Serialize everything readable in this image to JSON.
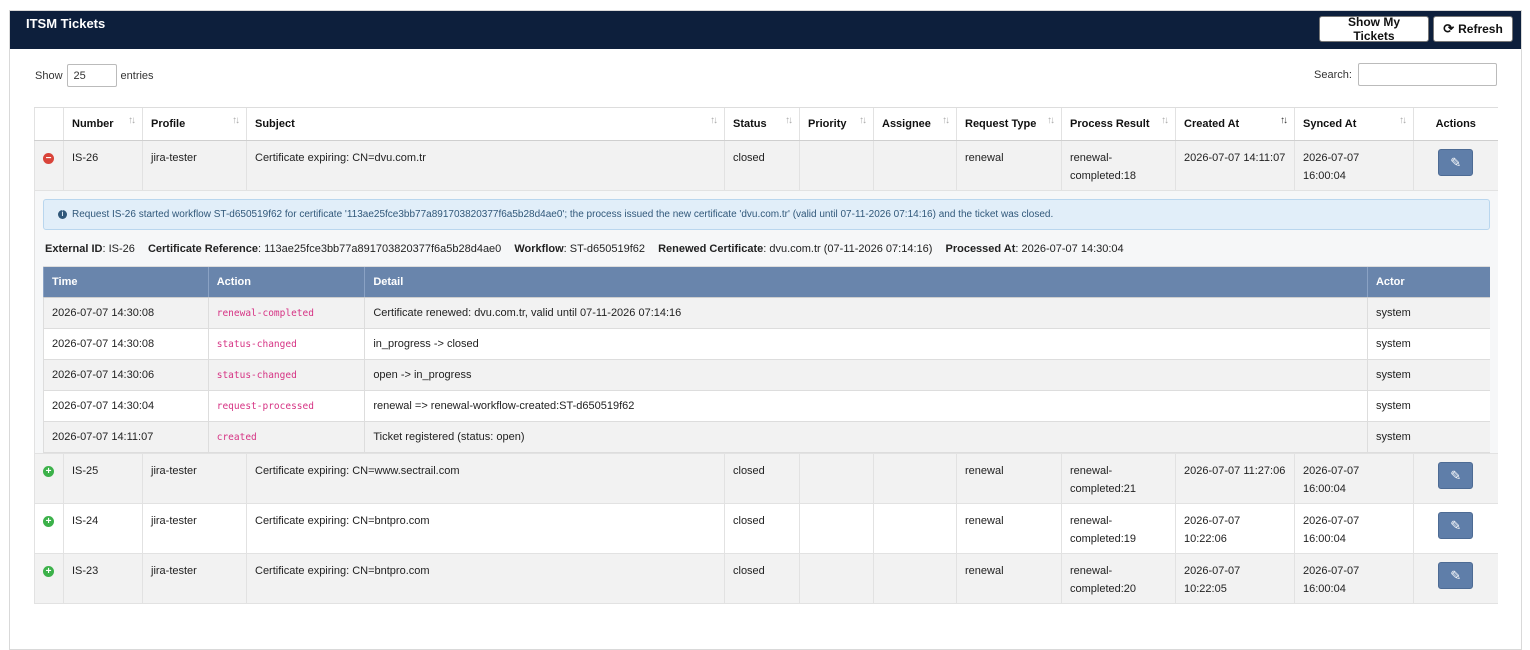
{
  "header": {
    "title": "ITSM Tickets",
    "show_my_tickets": "Show My Tickets",
    "refresh": "Refresh"
  },
  "controls": {
    "show_label": "Show",
    "page_length": "25",
    "entries_label": "entries",
    "search_label": "Search:"
  },
  "columns": [
    "Number",
    "Profile",
    "Subject",
    "Status",
    "Priority",
    "Assignee",
    "Request Type",
    "Process Result",
    "Created At",
    "Synced At",
    "Actions"
  ],
  "rows": [
    {
      "number": "IS-26",
      "profile": "jira-tester",
      "subject": "Certificate expiring: CN=dvu.com.tr",
      "status": "closed",
      "priority": "",
      "assignee": "",
      "request_type": "renewal",
      "process_result": "renewal-completed:18",
      "created_at": "2026-07-07 14:11:07",
      "synced_at": "2026-07-07 16:00:04"
    },
    {
      "number": "IS-25",
      "profile": "jira-tester",
      "subject": "Certificate expiring: CN=www.sectrail.com",
      "status": "closed",
      "priority": "",
      "assignee": "",
      "request_type": "renewal",
      "process_result": "renewal-completed:21",
      "created_at": "2026-07-07 11:27:06",
      "synced_at": "2026-07-07 16:00:04"
    },
    {
      "number": "IS-24",
      "profile": "jira-tester",
      "subject": "Certificate expiring: CN=bntpro.com",
      "status": "closed",
      "priority": "",
      "assignee": "",
      "request_type": "renewal",
      "process_result": "renewal-completed:19",
      "created_at": "2026-07-07 10:22:06",
      "synced_at": "2026-07-07 16:00:04"
    },
    {
      "number": "IS-23",
      "profile": "jira-tester",
      "subject": "Certificate expiring: CN=bntpro.com",
      "status": "closed",
      "priority": "",
      "assignee": "",
      "request_type": "renewal",
      "process_result": "renewal-completed:20",
      "created_at": "2026-07-07 10:22:05",
      "synced_at": "2026-07-07 16:00:04"
    }
  ],
  "detail": {
    "info": "Request IS-26 started workflow ST-d650519f62 for certificate '113ae25fce3bb77a891703820377f6a5b28d4ae0'; the process issued the new certificate 'dvu.com.tr' (valid until 07-11-2026 07:14:16) and the ticket was closed.",
    "external_id_label": "External ID",
    "external_id": "IS-26",
    "cert_ref_label": "Certificate Reference",
    "cert_ref": "113ae25fce3bb77a891703820377f6a5b28d4ae0",
    "workflow_label": "Workflow",
    "workflow": "ST-d650519f62",
    "renewed_label": "Renewed Certificate",
    "renewed": "dvu.com.tr (07-11-2026 07:14:16)",
    "processed_label": "Processed At",
    "processed": "2026-07-07 14:30:04",
    "history_columns": [
      "Time",
      "Action",
      "Detail",
      "Actor"
    ],
    "history": [
      {
        "time": "2026-07-07 14:30:08",
        "action": "renewal-completed",
        "detail": "Certificate renewed: dvu.com.tr, valid until 07-11-2026 07:14:16",
        "actor": "system"
      },
      {
        "time": "2026-07-07 14:30:08",
        "action": "status-changed",
        "detail": "in_progress -> closed",
        "actor": "system"
      },
      {
        "time": "2026-07-07 14:30:06",
        "action": "status-changed",
        "detail": "open -> in_progress",
        "actor": "system"
      },
      {
        "time": "2026-07-07 14:30:04",
        "action": "request-processed",
        "detail": "renewal => renewal-workflow-created:ST-d650519f62",
        "actor": "system"
      },
      {
        "time": "2026-07-07 14:11:07",
        "action": "created",
        "detail": "Ticket registered (status: open)",
        "actor": "system"
      }
    ]
  },
  "colors": {
    "header_bg": "#0d1f3c",
    "history_header_bg": "#6985ac",
    "edit_button": "#5f7ea9",
    "expand_open": "#d9443a",
    "expand_closed": "#3cb14a",
    "action_code": "#d63384"
  },
  "icons": {
    "refresh": "refresh-icon",
    "edit": "pencil-icon",
    "expand_open": "minus-circle-icon",
    "expand_closed": "plus-circle-icon",
    "info": "info-circle-icon"
  }
}
